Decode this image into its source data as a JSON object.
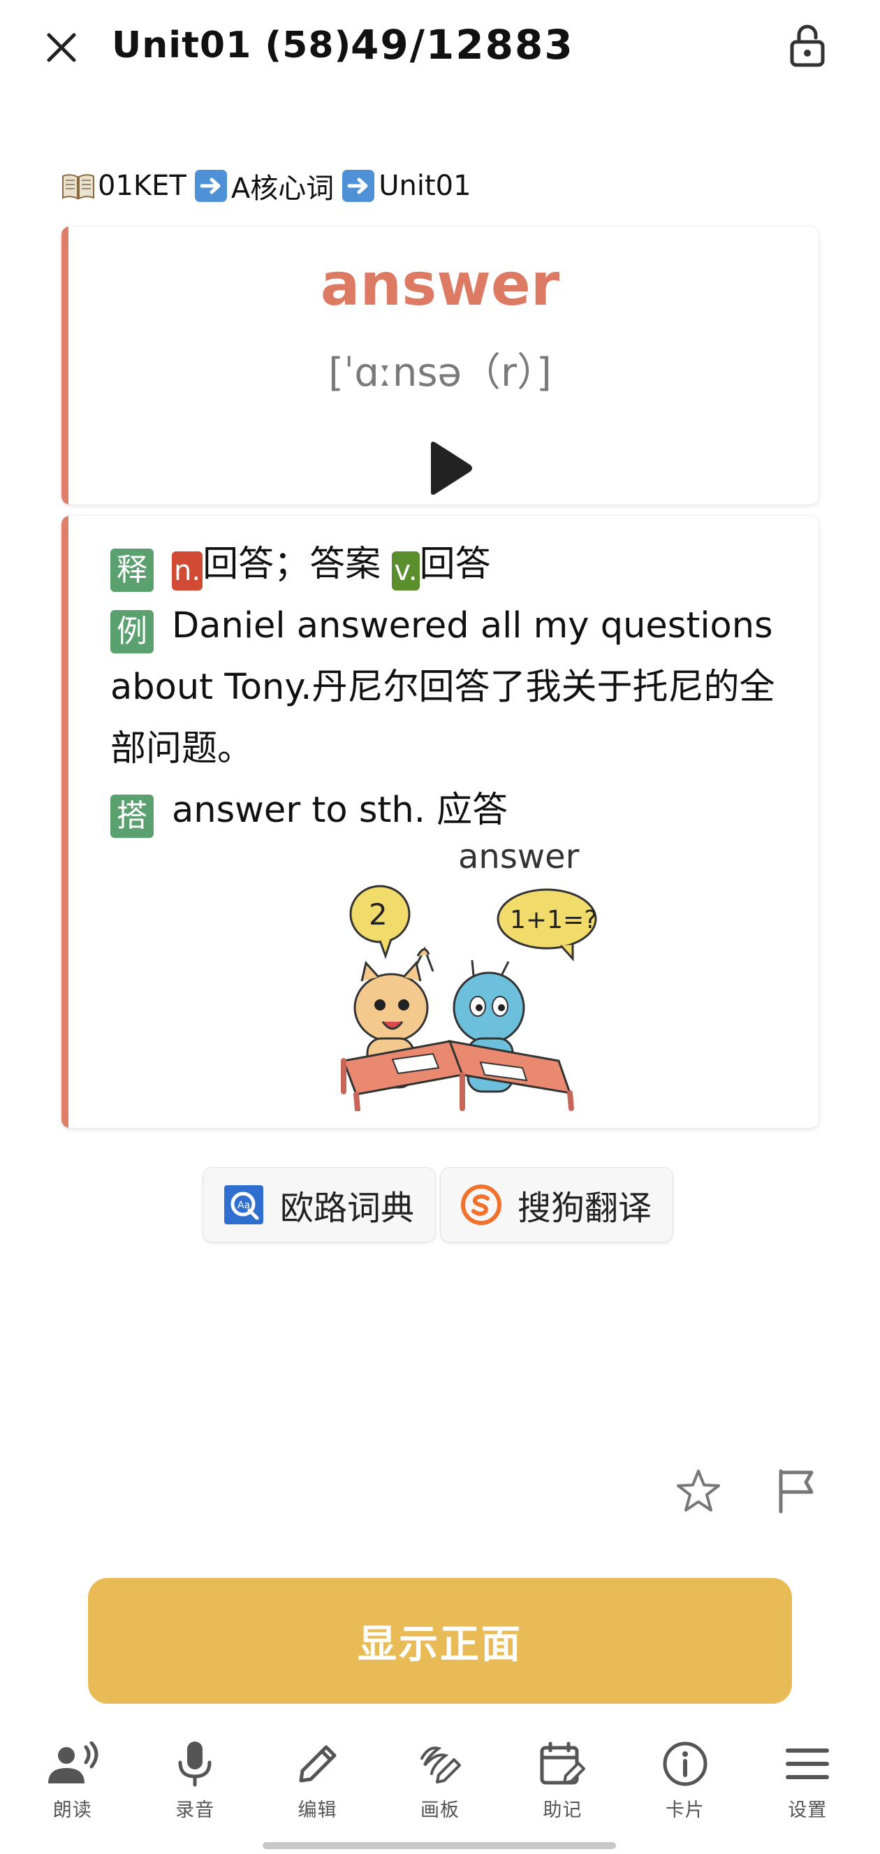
{
  "header": {
    "unit_title": "Unit01 (58)",
    "counter": "49/12883"
  },
  "breadcrumb": {
    "book": "01KET",
    "level": "A核心词",
    "unit": "Unit01"
  },
  "word_card": {
    "word": "answer",
    "phonetic": "[ˈɑːnsə（r）]"
  },
  "detail": {
    "meaning_tag": "释",
    "pos_noun": "n.",
    "meaning_noun": "回答；答案",
    "pos_verb": "v.",
    "meaning_verb": "回答",
    "example_tag": "例",
    "example": "Daniel answered all my questions about Tony.丹尼尔回答了我关于托尼的全部问题。",
    "collocation_tag": "搭",
    "collocation": "answer to sth. 应答",
    "image_caption": "answer",
    "image_bubble_left": "2",
    "image_bubble_right": "1+1=?"
  },
  "dictionaries": [
    {
      "label": "欧路词典",
      "icon": "eudic-icon"
    },
    {
      "label": "搜狗翻译",
      "icon": "sogou-icon"
    }
  ],
  "primary_button": "显示正面",
  "toolbar": [
    {
      "label": "朗读",
      "icon": "speak-icon"
    },
    {
      "label": "录音",
      "icon": "microphone-icon"
    },
    {
      "label": "编辑",
      "icon": "pencil-icon"
    },
    {
      "label": "画板",
      "icon": "drawing-board-icon"
    },
    {
      "label": "助记",
      "icon": "calendar-edit-icon"
    },
    {
      "label": "卡片",
      "icon": "info-icon"
    },
    {
      "label": "设置",
      "icon": "menu-icon"
    }
  ],
  "colors": {
    "word": "#dd7a63",
    "card_accent": "#e07f69",
    "tag_green": "#5aa16f",
    "pos_noun": "#d14b34",
    "pos_verb": "#5b8f2e",
    "primary_button": "#e8bb56"
  }
}
